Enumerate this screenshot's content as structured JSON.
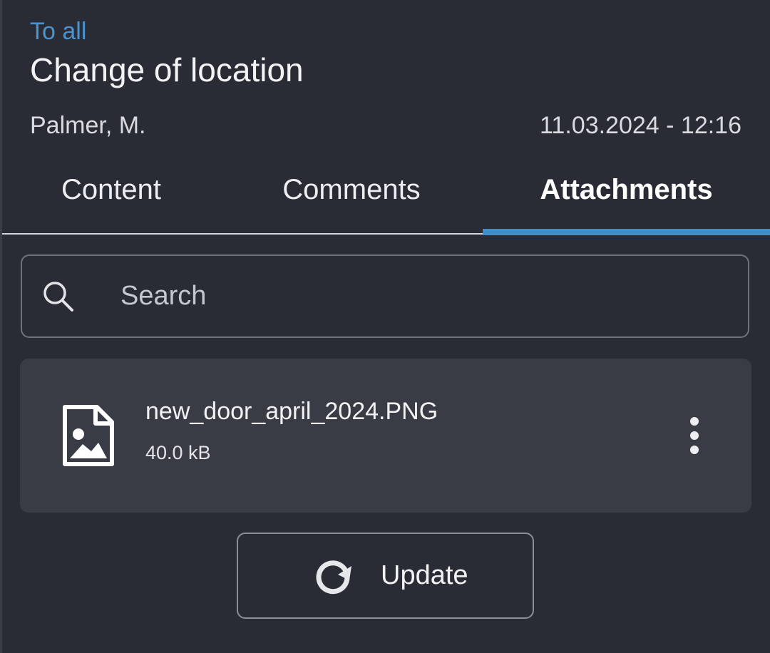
{
  "header": {
    "back_label": "To all",
    "title": "Change of location",
    "author": "Palmer, M.",
    "timestamp": "11.03.2024 - 12:16"
  },
  "tabs": [
    {
      "label": "Content",
      "active": false
    },
    {
      "label": "Comments",
      "active": false
    },
    {
      "label": "Attachments",
      "active": true
    }
  ],
  "search": {
    "placeholder": "Search",
    "value": "",
    "icon": "search-icon"
  },
  "attachments": [
    {
      "name": "new_door_april_2024.PNG",
      "size": "40.0 kB",
      "icon": "image-file-icon"
    }
  ],
  "update_button": {
    "label": "Update",
    "icon": "refresh-icon"
  },
  "colors": {
    "background": "#292c35",
    "card": "#393c44",
    "accent": "#3f8fcc",
    "link": "#4a93cf"
  }
}
